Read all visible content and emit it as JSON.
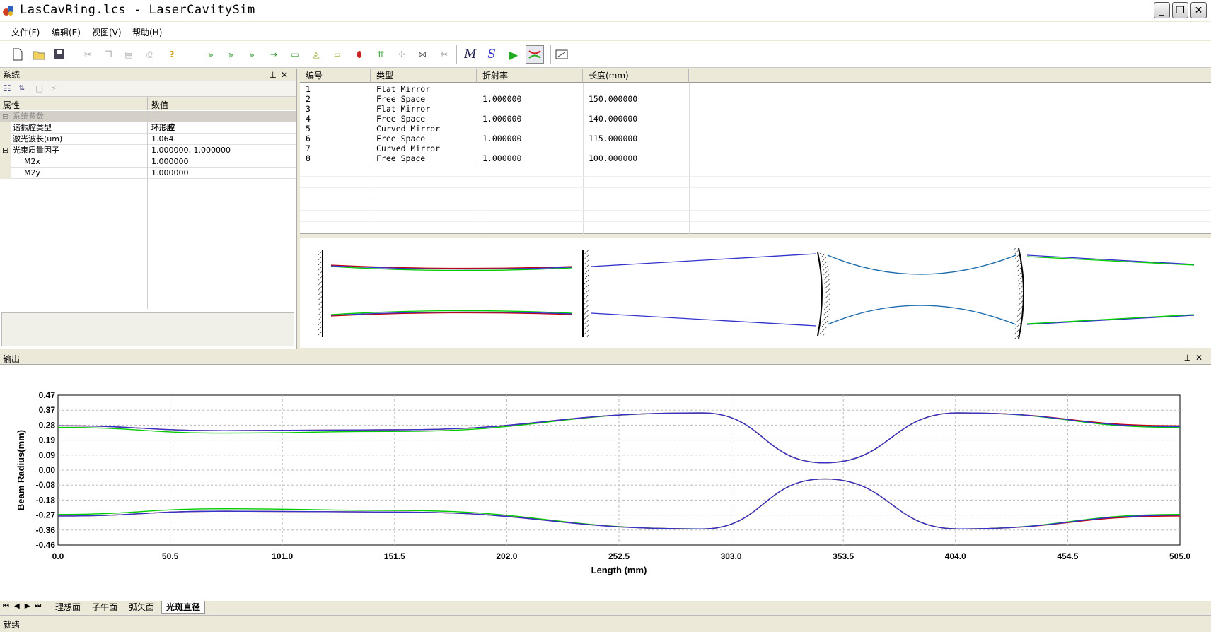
{
  "window": {
    "title": "LasCavRing.lcs - LaserCavitySim"
  },
  "menu": [
    "文件(F)",
    "编辑(E)",
    "视图(V)",
    "帮助(H)"
  ],
  "toolbar_icons": [
    "new-file-icon",
    "open-folder-icon",
    "save-icon",
    "cut-icon",
    "copy-icon",
    "paste-icon",
    "print-icon",
    "help-icon",
    "add-flat-mirror-icon",
    "add-curved-mirror-icon",
    "add-lens-icon",
    "add-free-space-icon",
    "add-crystal-icon",
    "add-prism-icon",
    "add-grating-icon",
    "add-aperture-icon",
    "add-rotation-icon",
    "add-shift-icon",
    "add-brewster-icon",
    "delete-element-icon",
    "matrix-m-icon",
    "stability-s-icon",
    "run-icon",
    "beam-profile-icon",
    "view-diagram-icon"
  ],
  "system_panel": {
    "title": "系统",
    "col_property": "属性",
    "col_value": "数值",
    "group_system": "系统参数",
    "rows": [
      {
        "name": "谐振腔类型",
        "value": "环形腔"
      },
      {
        "name": "激光波长(um)",
        "value": "1.064"
      },
      {
        "name": "光束质量因子",
        "value": "1.000000, 1.000000"
      },
      {
        "name": "M2x",
        "value": "1.000000"
      },
      {
        "name": "M2y",
        "value": "1.000000"
      }
    ]
  },
  "element_table": {
    "columns": [
      "编号",
      "类型",
      "折射率",
      "长度(mm)"
    ],
    "rows": [
      {
        "id": "1",
        "type": "Flat Mirror",
        "n": "",
        "len": ""
      },
      {
        "id": "2",
        "type": "Free Space",
        "n": "1.000000",
        "len": "150.000000"
      },
      {
        "id": "3",
        "type": "Flat Mirror",
        "n": "",
        "len": ""
      },
      {
        "id": "4",
        "type": "Free Space",
        "n": "1.000000",
        "len": "140.000000"
      },
      {
        "id": "5",
        "type": "Curved Mirror",
        "n": "",
        "len": ""
      },
      {
        "id": "6",
        "type": "Free Space",
        "n": "1.000000",
        "len": "115.000000"
      },
      {
        "id": "7",
        "type": "Curved Mirror",
        "n": "",
        "len": ""
      },
      {
        "id": "8",
        "type": "Free Space",
        "n": "1.000000",
        "len": "100.000000"
      }
    ]
  },
  "output_panel": {
    "title": "输出"
  },
  "chart_data": {
    "type": "line",
    "xlabel": "Length (mm)",
    "ylabel": "Beam Radius(mm)",
    "xlim": [
      0.0,
      505.0
    ],
    "ylim": [
      -0.46,
      0.47
    ],
    "x_ticks": [
      "0.0",
      "50.5",
      "101.0",
      "151.5",
      "202.0",
      "252.5",
      "303.0",
      "353.5",
      "404.0",
      "454.5",
      "505.0"
    ],
    "y_ticks": [
      "0.47",
      "0.37",
      "0.28",
      "0.19",
      "0.09",
      "0.00",
      "-0.08",
      "-0.18",
      "-0.27",
      "-0.36",
      "-0.46"
    ],
    "grid": true,
    "series": [
      {
        "color": "#00cc00",
        "x": [
          0,
          75,
          150,
          290,
          345,
          405,
          505
        ],
        "y": [
          0.27,
          0.235,
          0.245,
          0.36,
          0.05,
          0.36,
          0.27
        ]
      },
      {
        "color": "#cc0000",
        "x": [
          0,
          75,
          150,
          290,
          345,
          405,
          505
        ],
        "y": [
          0.28,
          0.25,
          0.255,
          0.36,
          0.05,
          0.36,
          0.28
        ]
      },
      {
        "color": "#3333cc",
        "x": [
          0,
          75,
          150,
          290,
          345,
          405,
          505
        ],
        "y": [
          0.28,
          0.25,
          0.255,
          0.36,
          0.05,
          0.36,
          0.275
        ]
      },
      {
        "color": "#00cc00",
        "x": [
          0,
          75,
          150,
          290,
          345,
          405,
          505
        ],
        "y": [
          -0.27,
          -0.235,
          -0.245,
          -0.36,
          -0.05,
          -0.36,
          -0.27
        ]
      },
      {
        "color": "#cc0000",
        "x": [
          0,
          75,
          150,
          290,
          345,
          405,
          505
        ],
        "y": [
          -0.28,
          -0.25,
          -0.255,
          -0.36,
          -0.05,
          -0.36,
          -0.28
        ]
      },
      {
        "color": "#3333cc",
        "x": [
          0,
          75,
          150,
          290,
          345,
          405,
          505
        ],
        "y": [
          -0.28,
          -0.25,
          -0.255,
          -0.36,
          -0.05,
          -0.36,
          -0.275
        ]
      }
    ]
  },
  "tabs": [
    "理想面",
    "子午面",
    "弧矢面",
    "光斑直径"
  ],
  "active_tab": "光斑直径",
  "status": "就绪"
}
